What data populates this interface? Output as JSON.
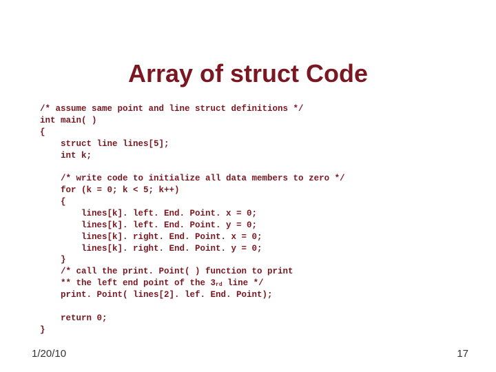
{
  "title": "Array of struct Code",
  "code": {
    "l1": "/* assume same point and line struct definitions */",
    "l2": "int main( )",
    "l3": "{",
    "l4": "    struct line lines[5];",
    "l5": "    int k;",
    "l6": "",
    "l7": "    /* write code to initialize all data members to zero */",
    "l8": "    for (k = 0; k < 5; k++)",
    "l9": "    {",
    "l10": "        lines[k]. left. End. Point. x = 0;",
    "l11": "        lines[k]. left. End. Point. y = 0;",
    "l12": "        lines[k]. right. End. Point. x = 0;",
    "l13": "        lines[k]. right. End. Point. y = 0;",
    "l14": "    }",
    "l15": "    /* call the print. Point( ) function to print",
    "l16a": "    ** the left end point of the 3",
    "ord": "rd",
    "l16b": " line */",
    "l17": "    print. Point( lines[2]. lef. End. Point);",
    "l18": "",
    "l19": "    return 0;",
    "l20": "}"
  },
  "footer": {
    "date": "1/20/10",
    "page": "17"
  }
}
